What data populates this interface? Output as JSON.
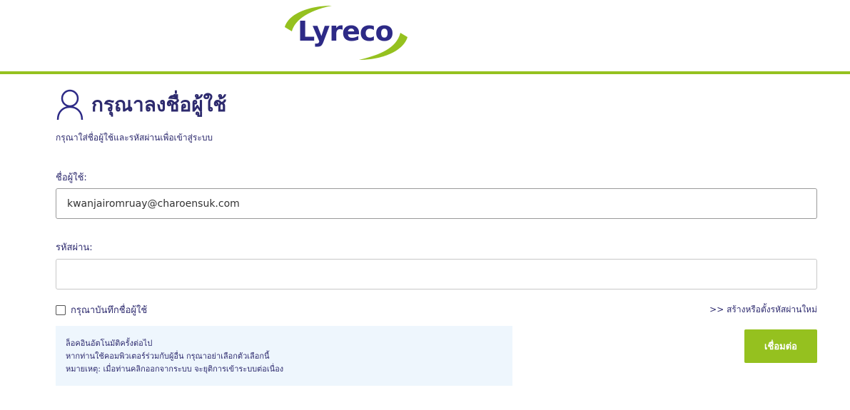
{
  "brand": {
    "logo_text": "Lyreco",
    "accent_color": "#95c11f",
    "text_color": "#2d2a6e"
  },
  "login": {
    "title": "กรุณาลงชื่อผู้ใช้",
    "subtitle": "กรุณาใส่ชื่อผู้ใช้และรหัสผ่านเพื่อเข้าสู่ระบบ",
    "username_label": "ชื่อผู้ใช้:",
    "username_value": "kwanjairomruay@charoensuk.com",
    "password_label": "รหัสผ่าน:",
    "password_value": "",
    "remember_label": "กรุณาบันทึกชื่อผู้ใช้",
    "remember_checked": false,
    "reset_link": ">> สร้างหรือตั้งรหัสผ่านใหม่",
    "info_lines": [
      "ล็อคอินอัตโนมัติครั้งต่อไป",
      "หากท่านใช้คอมพิวเตอร์ร่วมกับผู้อื่น กรุณาอย่าเลือกตัวเลือกนี้",
      "หมายเหตุ: เมื่อท่านคลิกออกจากระบบ จะยุติการเข้าระบบต่อเนื่อง"
    ],
    "submit_label": "เชื่อมต่อ"
  },
  "icons": {
    "user": "user-outline-icon",
    "logo_swoosh": "lyreco-swoosh-icon"
  }
}
